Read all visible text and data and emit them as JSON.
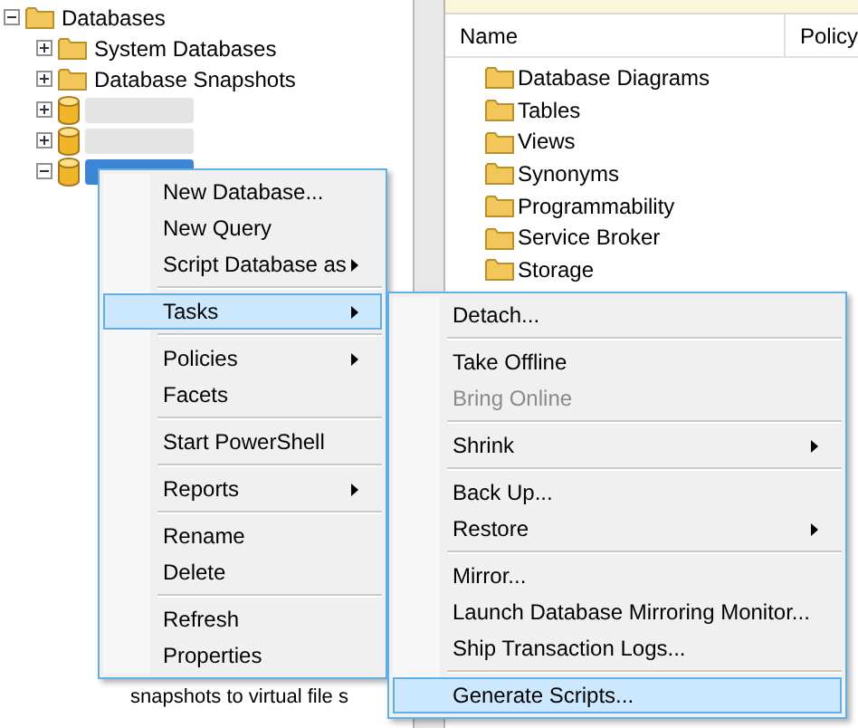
{
  "tree": {
    "label": "Databases",
    "expanded": true,
    "children": [
      {
        "kind": "folder",
        "label": "System Databases",
        "expanded": false,
        "selected": false
      },
      {
        "kind": "folder",
        "label": "Database Snapshots",
        "expanded": false,
        "selected": false
      },
      {
        "kind": "database",
        "expanded": false,
        "selected": false
      },
      {
        "kind": "database",
        "expanded": false,
        "selected": false
      },
      {
        "kind": "database",
        "expanded": true,
        "selected": true
      }
    ],
    "trailing_row": "snapshots to virtual file s"
  },
  "details": {
    "columns": [
      "Name",
      "Policy"
    ],
    "rows": [
      "Database Diagrams",
      "Tables",
      "Views",
      "Synonyms",
      "Programmability",
      "Service Broker",
      "Storage"
    ]
  },
  "context_menu": {
    "items": [
      {
        "kind": "item",
        "label": "New Database...",
        "submenu": false,
        "selected": false,
        "disabled": false
      },
      {
        "kind": "item",
        "label": "New Query",
        "submenu": false,
        "selected": false,
        "disabled": false
      },
      {
        "kind": "item",
        "label": "Script Database as",
        "submenu": true,
        "selected": false,
        "disabled": false
      },
      {
        "kind": "separator"
      },
      {
        "kind": "item",
        "label": "Tasks",
        "submenu": true,
        "selected": true,
        "disabled": false
      },
      {
        "kind": "separator"
      },
      {
        "kind": "item",
        "label": "Policies",
        "submenu": true,
        "selected": false,
        "disabled": false
      },
      {
        "kind": "item",
        "label": "Facets",
        "submenu": false,
        "selected": false,
        "disabled": false
      },
      {
        "kind": "separator"
      },
      {
        "kind": "item",
        "label": "Start PowerShell",
        "submenu": false,
        "selected": false,
        "disabled": false
      },
      {
        "kind": "separator"
      },
      {
        "kind": "item",
        "label": "Reports",
        "submenu": true,
        "selected": false,
        "disabled": false
      },
      {
        "kind": "separator"
      },
      {
        "kind": "item",
        "label": "Rename",
        "submenu": false,
        "selected": false,
        "disabled": false
      },
      {
        "kind": "item",
        "label": "Delete",
        "submenu": false,
        "selected": false,
        "disabled": false
      },
      {
        "kind": "separator"
      },
      {
        "kind": "item",
        "label": "Refresh",
        "submenu": false,
        "selected": false,
        "disabled": false
      },
      {
        "kind": "item",
        "label": "Properties",
        "submenu": false,
        "selected": false,
        "disabled": false
      }
    ]
  },
  "tasks_submenu": {
    "items": [
      {
        "kind": "item",
        "label": "Detach...",
        "submenu": false,
        "selected": false,
        "disabled": false
      },
      {
        "kind": "separator"
      },
      {
        "kind": "item",
        "label": "Take Offline",
        "submenu": false,
        "selected": false,
        "disabled": false
      },
      {
        "kind": "item",
        "label": "Bring Online",
        "submenu": false,
        "selected": false,
        "disabled": true
      },
      {
        "kind": "separator"
      },
      {
        "kind": "item",
        "label": "Shrink",
        "submenu": true,
        "selected": false,
        "disabled": false
      },
      {
        "kind": "separator"
      },
      {
        "kind": "item",
        "label": "Back Up...",
        "submenu": false,
        "selected": false,
        "disabled": false
      },
      {
        "kind": "item",
        "label": "Restore",
        "submenu": true,
        "selected": false,
        "disabled": false
      },
      {
        "kind": "separator"
      },
      {
        "kind": "item",
        "label": "Mirror...",
        "submenu": false,
        "selected": false,
        "disabled": false
      },
      {
        "kind": "item",
        "label": "Launch Database Mirroring Monitor...",
        "submenu": false,
        "selected": false,
        "disabled": false
      },
      {
        "kind": "item",
        "label": "Ship Transaction Logs...",
        "submenu": false,
        "selected": false,
        "disabled": false
      },
      {
        "kind": "separator"
      },
      {
        "kind": "item",
        "label": "Generate Scripts...",
        "submenu": false,
        "selected": true,
        "disabled": false
      }
    ]
  }
}
